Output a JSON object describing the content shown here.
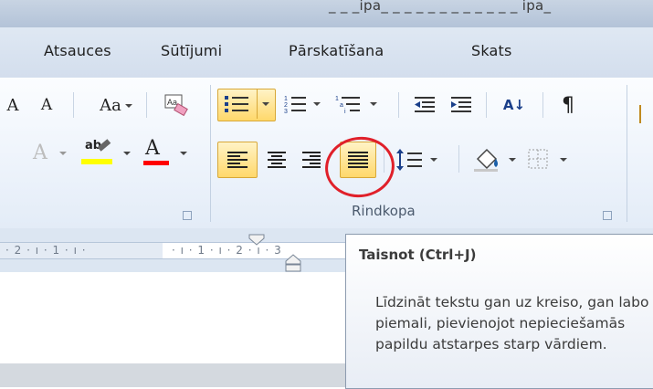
{
  "title_bar": {
    "text": "_ _ _ipa_ _ _ _ _ _ _ _ _ _ _ _ ipa_"
  },
  "tabs": [
    {
      "label": "Atsauces"
    },
    {
      "label": "Sūtījumi"
    },
    {
      "label": "Pārskatīšana"
    },
    {
      "label": "Skats"
    }
  ],
  "ribbon": {
    "font_group": {
      "case_button": "Aa",
      "grow_font": "A",
      "shrink_font": "A",
      "highlight_label": "ab",
      "font_color_label": "A",
      "text_effect_label": "A",
      "phonetic_label": "Ab"
    },
    "paragraph_group": {
      "label": "Rindkopa",
      "sort_label": "A↓",
      "pilcrow": "¶",
      "selected_button": "justify"
    },
    "colors": {
      "highlight": "#ffff00",
      "font_color": "#ff0000",
      "active_bg": "#ffd86b",
      "annotation": "#e0202a"
    }
  },
  "ruler": {
    "left_text": "· 2 · ı · 1 · ı ·",
    "right_text": "· ı · 1 · ı · 2 · ı · 3"
  },
  "tooltip": {
    "title": "Taisnot (Ctrl+J)",
    "body": "Līdzināt tekstu gan uz kreiso, gan labo piemali, pievienojot nepieciešamās papildu atstarpes starp vārdiem."
  }
}
